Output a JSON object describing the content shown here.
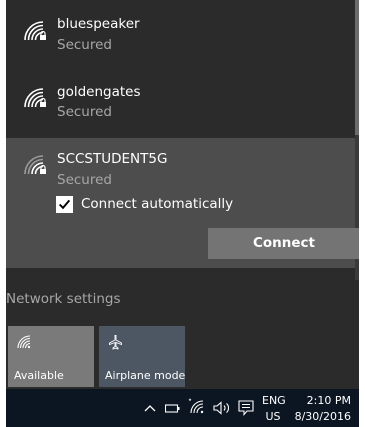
{
  "networks": [
    {
      "name": "bluespeaker",
      "status": "Secured",
      "icon": "wifi-secured-icon"
    },
    {
      "name": "goldengates",
      "status": "Secured",
      "icon": "wifi-secured-icon"
    },
    {
      "name": "SCCSTUDENT5G",
      "status": "Secured",
      "icon": "wifi-secured-icon"
    }
  ],
  "selected_network": {
    "connect_automatically_label": "Connect automatically",
    "connect_automatically_checked": true,
    "connect_button_label": "Connect"
  },
  "network_settings_label": "Network settings",
  "quick_actions": [
    {
      "label": "Available",
      "icon": "wifi-icon"
    },
    {
      "label": "Airplane mode",
      "icon": "airplane-icon"
    }
  ],
  "taskbar": {
    "language_top": "ENG",
    "language_bottom": "US",
    "time": "2:10 PM",
    "date": "8/30/2016"
  },
  "colors": {
    "flyout_bg": "#2b2b2b",
    "selected_bg": "#4d4d4d",
    "connect_button_bg": "#747474",
    "secondary_text": "#a7a7a7",
    "taskbar_bg": "#0c1522",
    "tile_available_bg": "#7a7a7a",
    "tile_airplane_bg": "#4d5764"
  }
}
